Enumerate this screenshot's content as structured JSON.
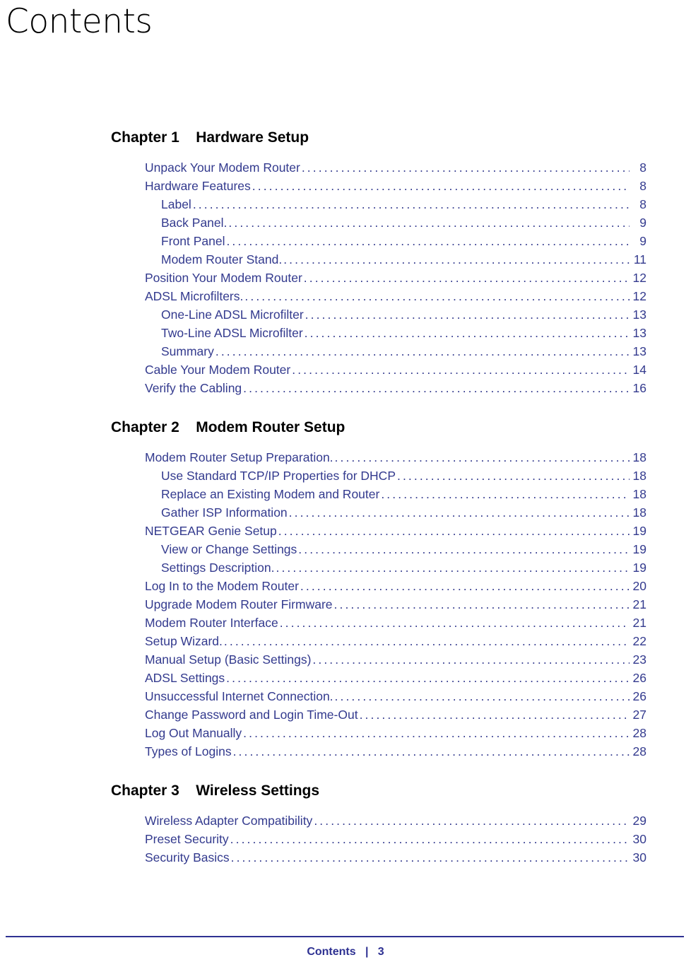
{
  "document": {
    "title": "Contents"
  },
  "footer": {
    "label": "Contents",
    "separator": "|",
    "page_number": "3",
    "text": "Contents   |   3"
  },
  "colors": {
    "entry_text": "#333a8e",
    "footer": "#2e3192",
    "heading": "#000000",
    "rule": "#2e3192",
    "background": "#ffffff"
  },
  "chapters": [
    {
      "number": "Chapter 1",
      "name": "Hardware Setup",
      "heading": "Chapter 1    Hardware Setup",
      "entries": [
        {
          "label": "Unpack Your Modem Router",
          "page": "8",
          "level": 1
        },
        {
          "label": "Hardware Features",
          "page": "8",
          "level": 1
        },
        {
          "label": "Label",
          "page": "8",
          "level": 2
        },
        {
          "label": "Back Panel.",
          "page": "9",
          "level": 2
        },
        {
          "label": "Front Panel",
          "page": "9",
          "level": 2
        },
        {
          "label": "Modem Router Stand.",
          "page": "11",
          "level": 2
        },
        {
          "label": "Position Your Modem Router",
          "page": "12",
          "level": 1
        },
        {
          "label": "ADSL Microfilters.",
          "page": "12",
          "level": 1
        },
        {
          "label": "One-Line ADSL Microfilter",
          "page": "13",
          "level": 2
        },
        {
          "label": "Two-Line ADSL Microfilter",
          "page": "13",
          "level": 2
        },
        {
          "label": "Summary",
          "page": "13",
          "level": 2
        },
        {
          "label": "Cable Your Modem Router",
          "page": "14",
          "level": 1
        },
        {
          "label": "Verify the Cabling",
          "page": "16",
          "level": 1
        }
      ]
    },
    {
      "number": "Chapter 2",
      "name": "Modem Router Setup",
      "heading": "Chapter 2    Modem Router Setup",
      "entries": [
        {
          "label": "Modem Router Setup Preparation.",
          "page": "18",
          "level": 1
        },
        {
          "label": "Use Standard TCP/IP Properties for DHCP",
          "page": "18",
          "level": 2
        },
        {
          "label": "Replace an Existing Modem and Router",
          "page": "18",
          "level": 2
        },
        {
          "label": "Gather ISP Information",
          "page": "18",
          "level": 2
        },
        {
          "label": "NETGEAR Genie Setup",
          "page": "19",
          "level": 1
        },
        {
          "label": "View or Change Settings",
          "page": "19",
          "level": 2
        },
        {
          "label": "Settings Description.",
          "page": "19",
          "level": 2
        },
        {
          "label": "Log In to the Modem Router",
          "page": "20",
          "level": 1
        },
        {
          "label": "Upgrade Modem Router Firmware",
          "page": "21",
          "level": 1
        },
        {
          "label": "Modem Router Interface",
          "page": "21",
          "level": 1
        },
        {
          "label": "Setup Wizard.",
          "page": "22",
          "level": 1
        },
        {
          "label": "Manual Setup (Basic Settings)",
          "page": "23",
          "level": 1
        },
        {
          "label": "ADSL Settings",
          "page": "26",
          "level": 1
        },
        {
          "label": "Unsuccessful Internet Connection.",
          "page": "26",
          "level": 1
        },
        {
          "label": "Change Password and Login Time-Out",
          "page": "27",
          "level": 1
        },
        {
          "label": "Log Out Manually",
          "page": "28",
          "level": 1
        },
        {
          "label": "Types of Logins",
          "page": "28",
          "level": 1
        }
      ]
    },
    {
      "number": "Chapter 3",
      "name": "Wireless Settings",
      "heading": "Chapter 3    Wireless Settings",
      "entries": [
        {
          "label": "Wireless Adapter Compatibility",
          "page": "29",
          "level": 1
        },
        {
          "label": "Preset Security",
          "page": "30",
          "level": 1
        },
        {
          "label": "Security Basics",
          "page": "30",
          "level": 1
        }
      ]
    }
  ]
}
